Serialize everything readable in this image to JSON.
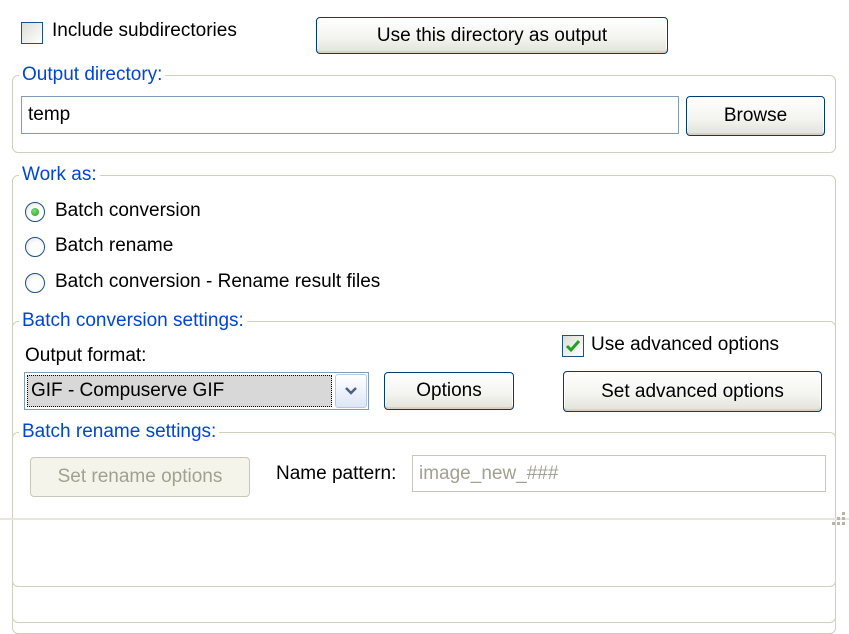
{
  "top": {
    "include_subdirectories": {
      "label": "Include subdirectories",
      "checked": false
    },
    "use_directory_button": "Use this directory as output"
  },
  "output_directory": {
    "legend": "Output directory:",
    "value": "temp",
    "browse_button": "Browse"
  },
  "work_as": {
    "legend": "Work as:",
    "options": [
      {
        "label": "Batch conversion",
        "selected": true
      },
      {
        "label": "Batch rename",
        "selected": false
      },
      {
        "label": "Batch conversion - Rename result files",
        "selected": false
      }
    ]
  },
  "batch_conversion": {
    "legend": "Batch conversion settings:",
    "output_format_label": "Output format:",
    "output_format_value": "GIF - Compuserve GIF",
    "options_button": "Options",
    "use_advanced": {
      "label": "Use advanced options",
      "checked": true
    },
    "set_advanced_button": "Set advanced options"
  },
  "batch_rename": {
    "legend": "Batch rename settings:",
    "set_rename_button": "Set rename options",
    "name_pattern_label": "Name pattern:",
    "name_pattern_value": "image_new_###"
  },
  "colors": {
    "legend_text": "#0046d5",
    "checkmark": "#21a121",
    "radio_dot": "#1f9e1f",
    "disabled_text": "#a1a192"
  }
}
